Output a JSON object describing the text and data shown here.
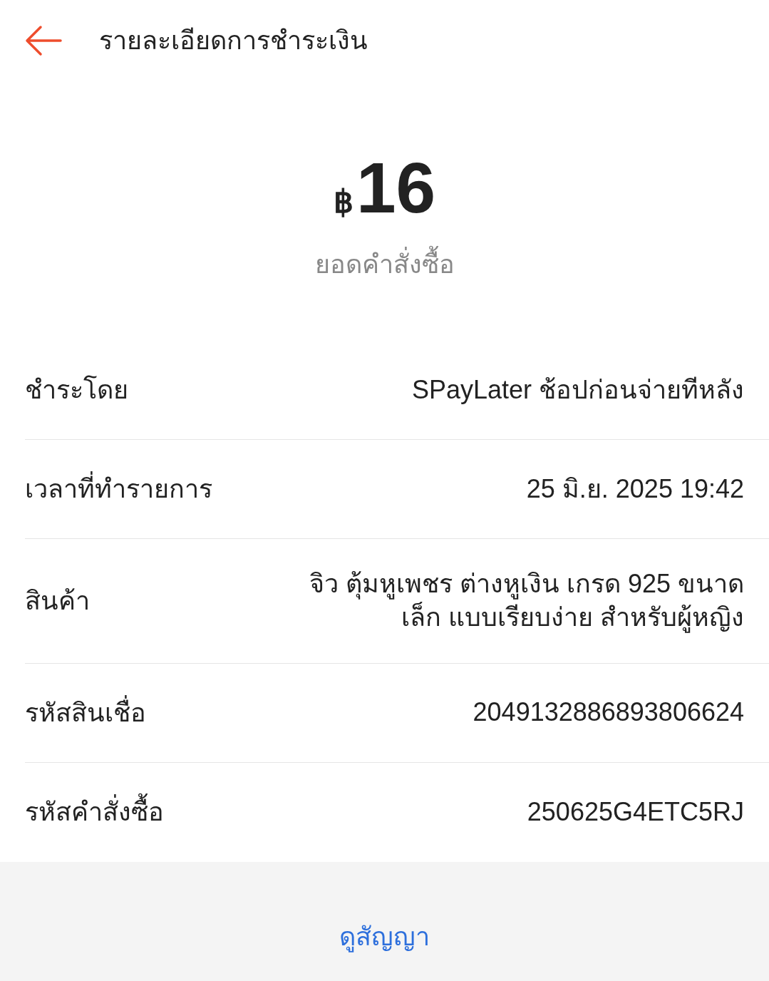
{
  "header": {
    "title": "รายละเอียดการชำระเงิน"
  },
  "amount": {
    "currency": "฿",
    "value": "16",
    "label": "ยอดคำสั่งซื้อ"
  },
  "details": [
    {
      "label": "ชำระโดย",
      "value": "SPayLater ช้อปก่อนจ่ายทีหลัง"
    },
    {
      "label": "เวลาที่ทำรายการ",
      "value": "25 มิ.ย. 2025 19:42"
    },
    {
      "label": "สินค้า",
      "value": "จิว ตุ้มหูเพชร ต่างหูเงิน เกรด 925 ขนาดเล็ก แบบเรียบง่าย สำหรับผู้หญิง"
    },
    {
      "label": "รหัสสินเชื่อ",
      "value": "2049132886893806624"
    },
    {
      "label": "รหัสคำสั่งซื้อ",
      "value": "250625G4ETC5RJ"
    }
  ],
  "footer": {
    "link": "ดูสัญญา"
  }
}
